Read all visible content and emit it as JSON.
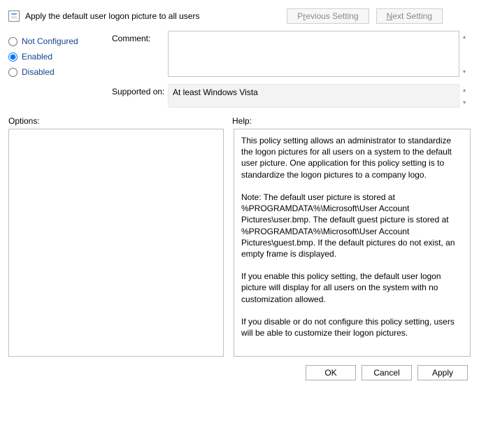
{
  "title": "Apply the default user logon picture to all users",
  "nav": {
    "previous": {
      "pre": "P",
      "u": "r",
      "post": "evious Setting"
    },
    "next": {
      "pre": "",
      "u": "N",
      "post": "ext Setting"
    }
  },
  "state": {
    "not_configured": "Not Configured",
    "enabled": "Enabled",
    "disabled": "Disabled",
    "selected": "enabled"
  },
  "comment_label": "Comment:",
  "comment_value": "",
  "supported_label": "Supported on:",
  "supported_value": "At least Windows Vista",
  "options_label": "Options:",
  "help_label": "Help:",
  "help_text": "This policy setting allows an administrator to standardize the logon pictures for all users on a system to the default user picture. One application for this policy setting is to standardize the logon pictures to a company logo.\n\nNote: The default user picture is stored at %PROGRAMDATA%\\Microsoft\\User Account Pictures\\user.bmp. The default guest picture is stored at %PROGRAMDATA%\\Microsoft\\User Account Pictures\\guest.bmp. If the default pictures do not exist, an empty frame is displayed.\n\nIf you enable this policy setting, the default user logon picture will display for all users on the system with no customization allowed.\n\nIf you disable or do not configure this policy setting, users will be able to customize their logon pictures.",
  "buttons": {
    "ok": "OK",
    "cancel": "Cancel",
    "apply": "Apply"
  }
}
